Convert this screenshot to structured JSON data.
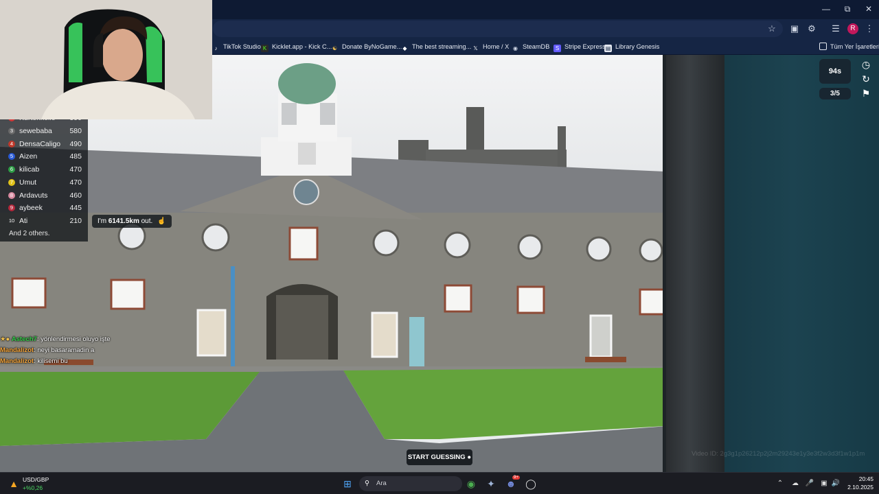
{
  "browser": {
    "bookmarks": [
      {
        "label": "TikTok Studio",
        "icon": "tiktok-icon"
      },
      {
        "label": "Kicklet.app - Kick C...",
        "icon": "kicklet-icon"
      },
      {
        "label": "Donate ByNoGame...",
        "icon": "bynogame-icon"
      },
      {
        "label": "The best streaming...",
        "icon": "diamond-icon"
      },
      {
        "label": "Home / X",
        "icon": "x-icon"
      },
      {
        "label": "SteamDB",
        "icon": "steamdb-icon"
      },
      {
        "label": "Stripe Express",
        "icon": "stripe-icon"
      },
      {
        "label": "Library Genesis",
        "icon": "book-icon"
      }
    ],
    "all_bookmarks_label": "Tüm Yer İşaretleri",
    "profile_initial": "R"
  },
  "game": {
    "timer": "94s",
    "round": "3/5",
    "distance_prefix": "I'm ",
    "distance_value": "6141.5km",
    "distance_suffix": " out.",
    "start_label": "START GUESSING",
    "video_id": "Video ID: 2g3g1p26212p2j2m29243e1y3e3f2w3d3f1w1p1m",
    "leaderboard": [
      {
        "rank": "2",
        "name": "Kurtonkelle",
        "score": "590",
        "color": "#d23a3a"
      },
      {
        "rank": "3",
        "name": "sewebaba",
        "score": "580",
        "color": "#6b6b6b"
      },
      {
        "rank": "4",
        "name": "DensaCaligo",
        "score": "490",
        "color": "#c0392b"
      },
      {
        "rank": "5",
        "name": "Aizen",
        "score": "485",
        "color": "#2a5bd7"
      },
      {
        "rank": "6",
        "name": "kilicab",
        "score": "470",
        "color": "#2e9e46"
      },
      {
        "rank": "7",
        "name": "Umut",
        "score": "470",
        "color": "#e0c21a"
      },
      {
        "rank": "8",
        "name": "Ardavuts",
        "score": "460",
        "color": "#d98aa0"
      },
      {
        "rank": "9",
        "name": "aybeek",
        "score": "445",
        "color": "#b5283b"
      },
      {
        "rank": "10",
        "name": "Ati",
        "score": "210",
        "color": "transparent"
      }
    ],
    "leaderboard_more": "And 2 others."
  },
  "chat": [
    {
      "user": "Astech7",
      "user_color": "#35d04a",
      "message": "yönlendirmesi oluyo işte"
    },
    {
      "user": "Mandalizot",
      "user_color": "#f2a33a",
      "message": "neyi basaramadin a"
    },
    {
      "user": "Mandalizot",
      "user_color": "#f2a33a",
      "message": "kilisemi bu"
    }
  ],
  "taskbar": {
    "widget_title": "USD/GBP",
    "widget_value": "+%0,26",
    "search_placeholder": "Ara",
    "time": "20:45",
    "date": "2.10.2025",
    "discord_badge": "9+"
  }
}
